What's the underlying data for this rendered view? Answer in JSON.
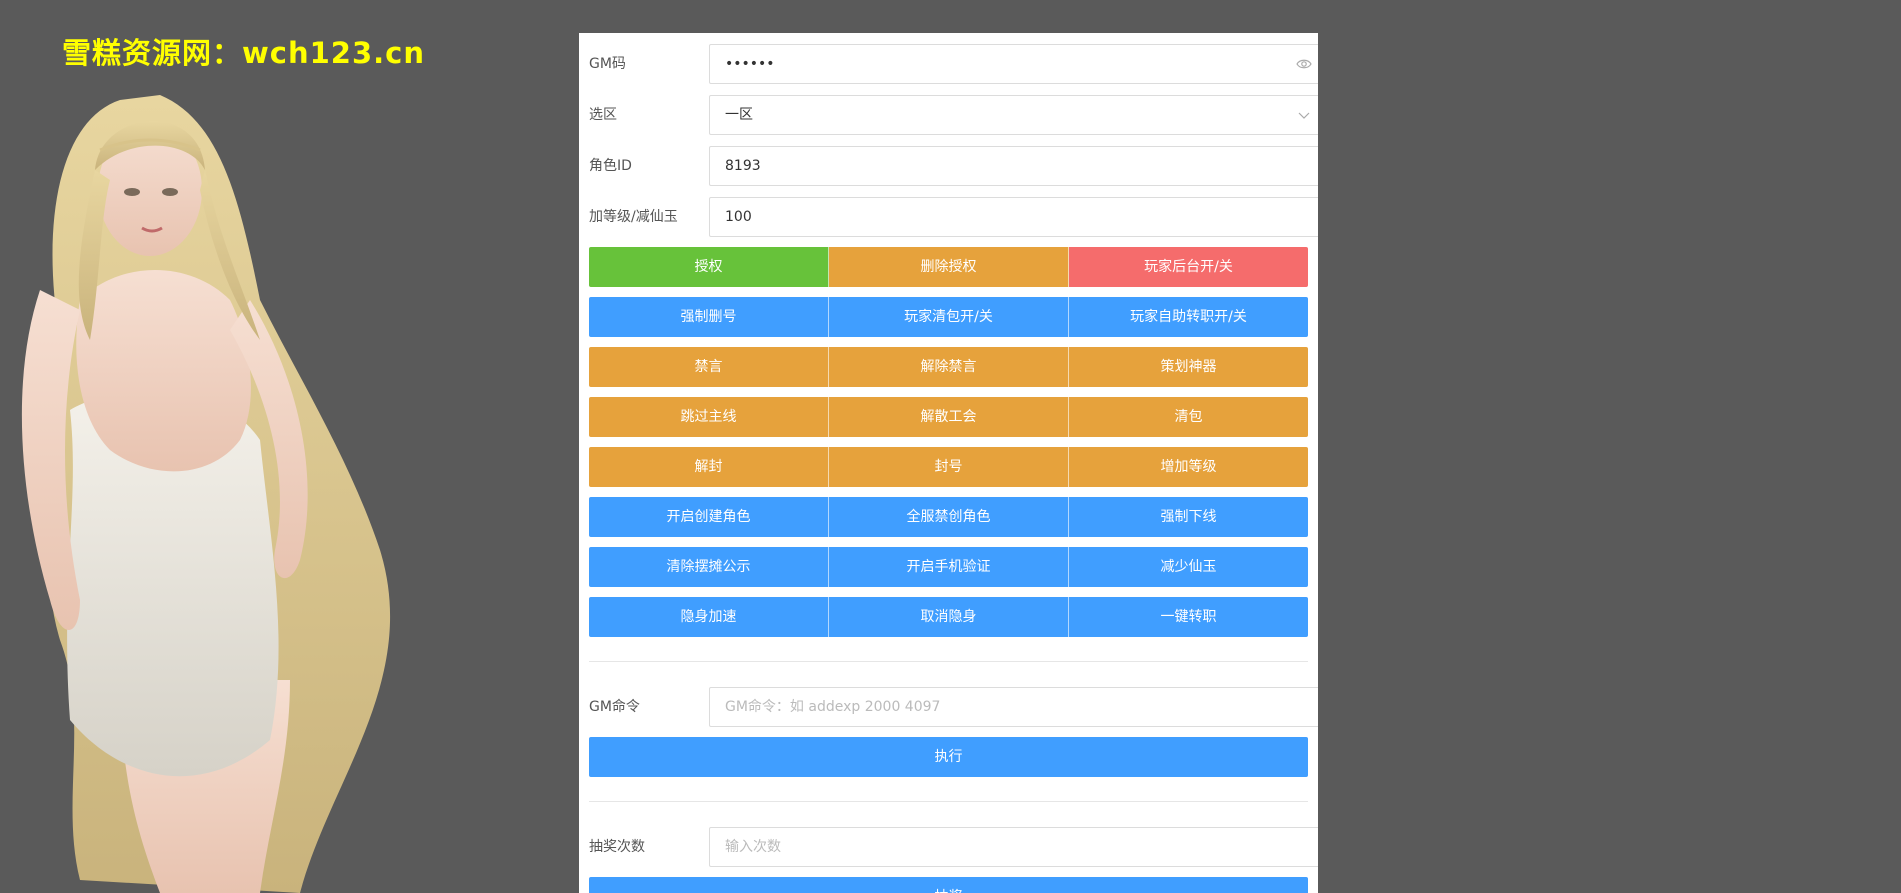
{
  "watermark": "雪糕资源网：wch123.cn",
  "form": {
    "gm_code": {
      "label": "GM码",
      "value": "••••••"
    },
    "zone": {
      "label": "选区",
      "value": "一区"
    },
    "role_id": {
      "label": "角色ID",
      "value": "8193"
    },
    "level": {
      "label": "加等级/减仙玉",
      "value": "100"
    }
  },
  "button_rows": [
    [
      {
        "label": "授权",
        "color": "#67c23a"
      },
      {
        "label": "删除授权",
        "color": "#e6a23c"
      },
      {
        "label": "玩家后台开/关",
        "color": "#f56c6c"
      }
    ],
    [
      {
        "label": "强制删号",
        "color": "#409eff"
      },
      {
        "label": "玩家清包开/关",
        "color": "#409eff"
      },
      {
        "label": "玩家自助转职开/关",
        "color": "#409eff"
      }
    ],
    [
      {
        "label": "禁言",
        "color": "#e6a23c"
      },
      {
        "label": "解除禁言",
        "color": "#e6a23c"
      },
      {
        "label": "策划神器",
        "color": "#e6a23c"
      }
    ],
    [
      {
        "label": "跳过主线",
        "color": "#e6a23c"
      },
      {
        "label": "解散工会",
        "color": "#e6a23c"
      },
      {
        "label": "清包",
        "color": "#e6a23c"
      }
    ],
    [
      {
        "label": "解封",
        "color": "#e6a23c"
      },
      {
        "label": "封号",
        "color": "#e6a23c"
      },
      {
        "label": "增加等级",
        "color": "#e6a23c"
      }
    ],
    [
      {
        "label": "开启创建角色",
        "color": "#409eff"
      },
      {
        "label": "全服禁创角色",
        "color": "#409eff"
      },
      {
        "label": "强制下线",
        "color": "#409eff"
      }
    ],
    [
      {
        "label": "清除摆摊公示",
        "color": "#409eff"
      },
      {
        "label": "开启手机验证",
        "color": "#409eff"
      },
      {
        "label": "减少仙玉",
        "color": "#409eff"
      }
    ],
    [
      {
        "label": "隐身加速",
        "color": "#409eff"
      },
      {
        "label": "取消隐身",
        "color": "#409eff"
      },
      {
        "label": "一键转职",
        "color": "#409eff"
      }
    ]
  ],
  "gm_command": {
    "label": "GM命令",
    "placeholder": "GM命令：如 addexp 2000 4097",
    "execute_label": "执行"
  },
  "lottery": {
    "label": "抽奖次数",
    "placeholder": "输入次数",
    "submit_label": "抽奖"
  },
  "icons": {
    "password": "eye-icon",
    "select": "chevron-down-icon"
  }
}
